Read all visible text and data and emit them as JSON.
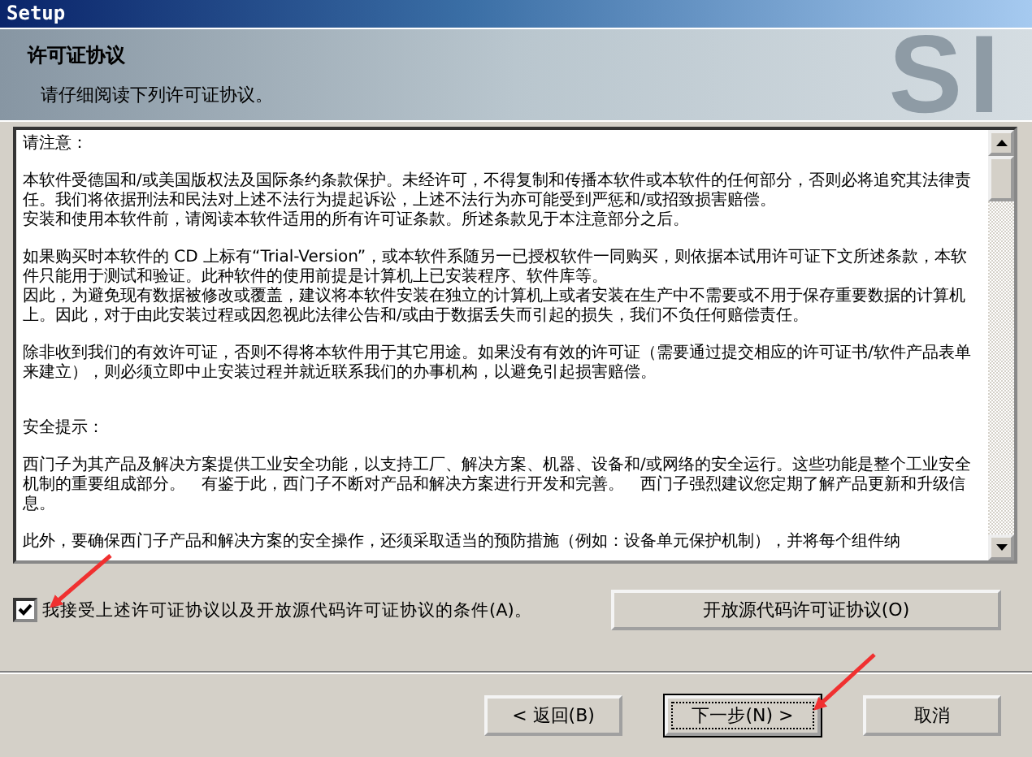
{
  "window": {
    "title": "Setup"
  },
  "header": {
    "title": "许可证协议",
    "subtitle": "请仔细阅读下列许可证协议。",
    "logo_text": "SI"
  },
  "license_text": {
    "paragraphs": [
      {
        "kind": "paragraph",
        "text": "请注意："
      },
      {
        "kind": "line",
        "text": "本软件受德国和/或美国版权法及国际条约条款保护。未经许可，不得复制和传播本软件或本软件的任何部分，否则必将追究其法律责任。我们将依据刑法和民法对上述不法行为提起诉讼，上述不法行为亦可能受到严惩和/或招致损害赔偿。"
      },
      {
        "kind": "paragraph",
        "text": "安装和使用本软件前，请阅读本软件适用的所有许可证条款。所述条款见于本注意部分之后。"
      },
      {
        "kind": "line",
        "text": "如果购买时本软件的 CD 上标有“Trial-Version”，或本软件系随另一已授权软件一同购买，则依据本试用许可证下文所述条款，本软件只能用于测试和验证。此种软件的使用前提是计算机上已安装程序、软件库等。"
      },
      {
        "kind": "paragraph",
        "text": "因此，为避免现有数据被修改或覆盖，建议将本软件安装在独立的计算机上或者安装在生产中不需要或不用于保存重要数据的计算机上。因此，对于由此安装过程或因忽视此法律公告和/或由于数据丢失而引起的损失，我们不负任何赔偿责任。"
      },
      {
        "kind": "section_end",
        "text": "除非收到我们的有效许可证，否则不得将本软件用于其它用途。如果没有有效的许可证（需要通过提交相应的许可证书/软件产品表单来建立），则必须立即中止安装过程并就近联系我们的办事机构，以避免引起损害赔偿。"
      },
      {
        "kind": "paragraph",
        "text": "安全提示："
      },
      {
        "kind": "paragraph",
        "text": "西门子为其产品及解决方案提供工业安全功能，以支持工厂、解决方案、机器、设备和/或网络的安全运行。这些功能是整个工业安全机制的重要组成部分。　有鉴于此，西门子不断对产品和解决方案进行开发和完善。　西门子强烈建议您定期了解产品更新和升级信息。"
      },
      {
        "kind": "paragraph",
        "text": "此外，要确保西门子产品和解决方案的安全操作，还须采取适当的预防措施（例如：设备单元保护机制），并将每个组件纳"
      }
    ]
  },
  "accept_checkbox": {
    "label": "我接受上述许可证协议以及开放源代码许可证协议的条件(A)。",
    "checked": true
  },
  "open_source_button": {
    "label": "开放源代码许可证协议(O)"
  },
  "buttons": [
    {
      "label": "< 返回(B)",
      "kind": "back",
      "focused": false
    },
    {
      "label": "下一步(N) >",
      "kind": "next",
      "focused": true
    },
    {
      "label": "取消",
      "kind": "cancel",
      "focused": false
    }
  ]
}
